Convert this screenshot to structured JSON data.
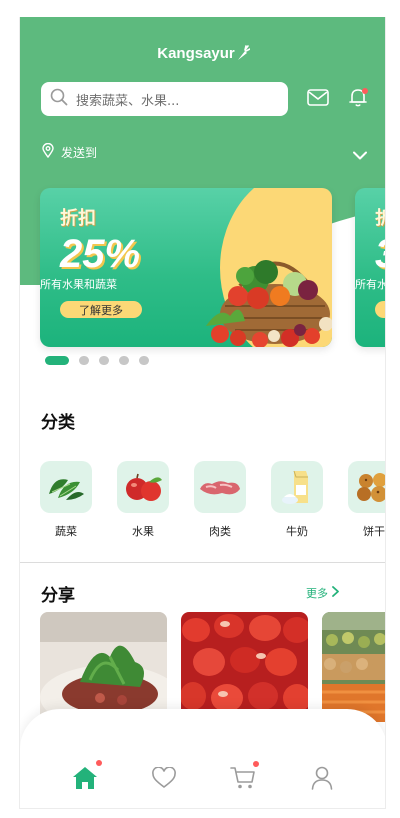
{
  "app": {
    "brand": "Kangsayur"
  },
  "header": {
    "search_placeholder": "搜索蔬菜、水果...",
    "location_label": "发送到"
  },
  "banners": [
    {
      "tag": "折扣",
      "percent": "25%",
      "subtitle": "所有水果和蔬菜",
      "button": "了解更多"
    },
    {
      "tag": "折扣",
      "percent": "3",
      "subtitle": "所有水",
      "button": ""
    }
  ],
  "carousel": {
    "pages": 5,
    "active_index": 0
  },
  "categories": {
    "title": "分类",
    "items": [
      {
        "label": "蔬菜",
        "icon": "spinach-icon"
      },
      {
        "label": "水果",
        "icon": "apple-icon"
      },
      {
        "label": "肉类",
        "icon": "meat-icon"
      },
      {
        "label": "牛奶",
        "icon": "milk-icon"
      },
      {
        "label": "饼干",
        "icon": "cookie-icon"
      }
    ]
  },
  "share": {
    "title": "分享",
    "more_label": "更多"
  },
  "tabbar": {
    "items": [
      {
        "name": "home",
        "icon": "home-icon",
        "active": true,
        "badge": true
      },
      {
        "name": "favorites",
        "icon": "heart-icon",
        "active": false,
        "badge": false
      },
      {
        "name": "cart",
        "icon": "cart-icon",
        "active": false,
        "badge": true
      },
      {
        "name": "profile",
        "icon": "user-icon",
        "active": false,
        "badge": false
      }
    ]
  },
  "colors": {
    "primary": "#23b27a",
    "header_green": "#5dba7e",
    "accent_yellow": "#fcd876",
    "badge_red": "#ff5b5b"
  }
}
